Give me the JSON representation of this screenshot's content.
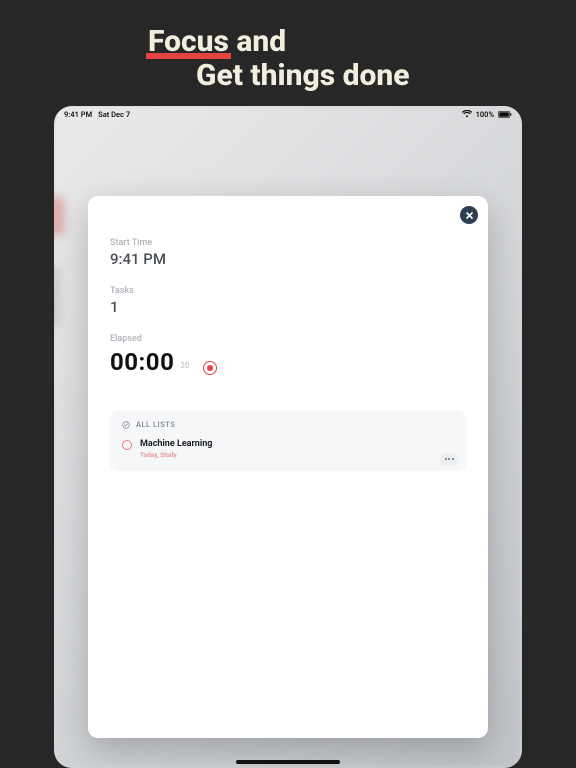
{
  "headline": {
    "word_focus": "Focus",
    "word_and": "and",
    "line2": "Get things done"
  },
  "status_bar": {
    "time": "9:41 PM",
    "date": "Sat Dec 7",
    "battery": "100%"
  },
  "modal": {
    "start_time_label": "Start Time",
    "start_time_value": "9:41 PM",
    "tasks_label": "Tasks",
    "tasks_value": "1",
    "elapsed_label": "Elapsed",
    "elapsed_main": "00:00",
    "elapsed_sub": "20"
  },
  "list": {
    "header": "ALL LISTS",
    "task": {
      "title": "Machine Learning",
      "meta": "Today, Study"
    }
  },
  "icons": {
    "close": "close-icon",
    "wifi": "wifi-icon",
    "battery": "battery-icon",
    "record": "record-icon",
    "check": "check-icon",
    "more": "more-icon"
  }
}
